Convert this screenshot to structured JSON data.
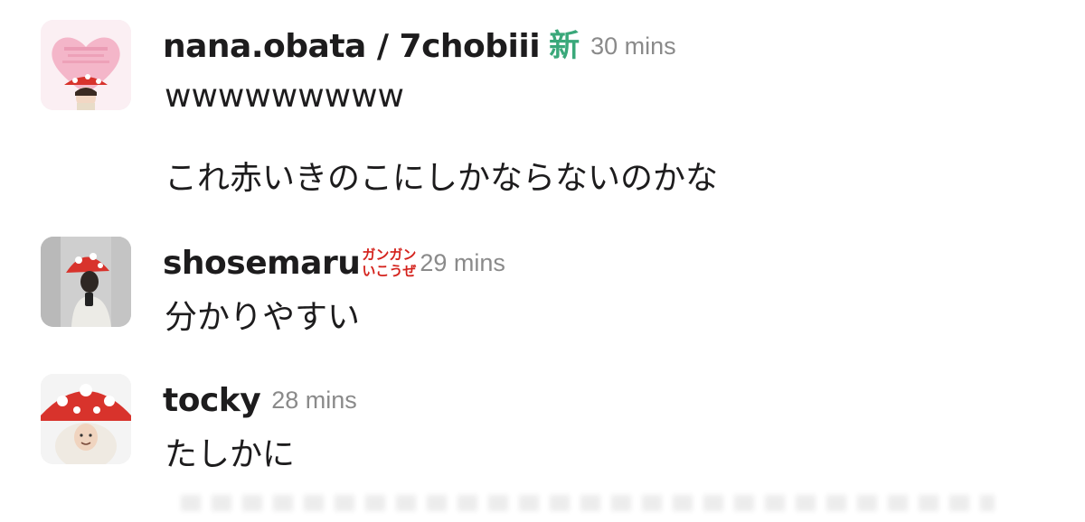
{
  "messages": [
    {
      "username": "nana.obata / 7chobiii",
      "status_emoji": "新",
      "timestamp": "30 mins",
      "lines": [
        "wwwwwwwww",
        "これ赤いきのこにしかならないのかな"
      ],
      "avatar": "pink-heart-mushroom-avatar"
    },
    {
      "username": "shosemaru",
      "status_emoji_lines": [
        "ガンガン",
        "いこうぜ"
      ],
      "timestamp": "29 mins",
      "lines": [
        "分かりやすい"
      ],
      "avatar": "mushroom-selfie-avatar"
    },
    {
      "username": "tocky",
      "timestamp": "28 mins",
      "lines": [
        "たしかに"
      ],
      "avatar": "mushroom-costume-avatar"
    }
  ],
  "colors": {
    "username": "#1d1c1d",
    "timestamp": "#8a8a8a",
    "emoji_new": "#3aa87a",
    "emoji_gangan": "#d4221c",
    "mushroom_red": "#d8332c"
  }
}
